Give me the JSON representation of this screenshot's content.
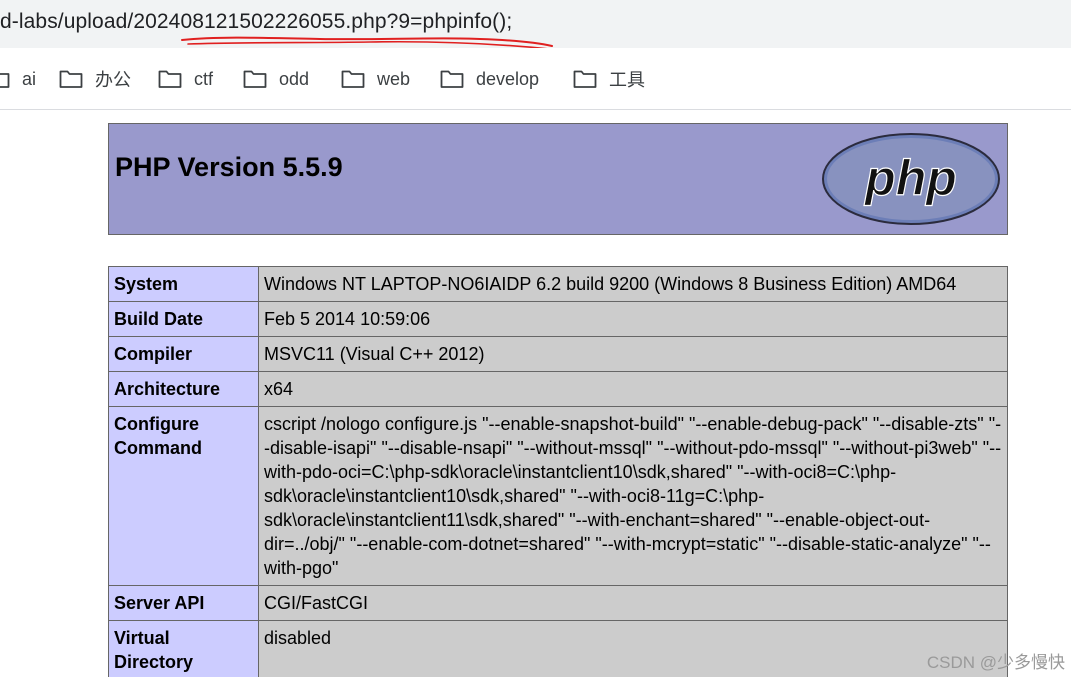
{
  "browser": {
    "url": "d-labs/upload/202408121502226055.php?9=phpinfo();",
    "bookmarks": [
      {
        "label": "ai"
      },
      {
        "label": "办公"
      },
      {
        "label": "ctf"
      },
      {
        "label": "odd"
      },
      {
        "label": "web"
      },
      {
        "label": "develop"
      },
      {
        "label": "工具"
      }
    ]
  },
  "phpinfo": {
    "title": "PHP Version 5.5.9",
    "logo_text": "php",
    "rows": [
      {
        "key": "System",
        "value": "Windows NT LAPTOP-NO6IAIDP 6.2 build 9200 (Windows 8 Business Edition) AMD64"
      },
      {
        "key": "Build Date",
        "value": "Feb 5 2014 10:59:06"
      },
      {
        "key": "Compiler",
        "value": "MSVC11 (Visual C++ 2012)"
      },
      {
        "key": "Architecture",
        "value": "x64"
      },
      {
        "key": "Configure Command",
        "value": "cscript /nologo configure.js \"--enable-snapshot-build\" \"--enable-debug-pack\" \"--disable-zts\" \"--disable-isapi\" \"--disable-nsapi\" \"--without-mssql\" \"--without-pdo-mssql\" \"--without-pi3web\" \"--with-pdo-oci=C:\\php-sdk\\oracle\\instantclient10\\sdk,shared\" \"--with-oci8=C:\\php-sdk\\oracle\\instantclient10\\sdk,shared\" \"--with-oci8-11g=C:\\php-sdk\\oracle\\instantclient11\\sdk,shared\" \"--with-enchant=shared\" \"--enable-object-out-dir=../obj/\" \"--enable-com-dotnet=shared\" \"--with-mcrypt=static\" \"--disable-static-analyze\" \"--with-pgo\""
      },
      {
        "key": "Server API",
        "value": "CGI/FastCGI"
      },
      {
        "key": "Virtual Directory Support",
        "value": "disabled"
      }
    ]
  },
  "watermark": "CSDN @少多慢快",
  "colors": {
    "header_bg": "#9999cc",
    "key_bg": "#ccccff",
    "value_bg": "#cccccc",
    "annotation": "#e02020"
  },
  "icons": {
    "bookmark": "folder-icon",
    "logo": "php-logo-icon"
  }
}
